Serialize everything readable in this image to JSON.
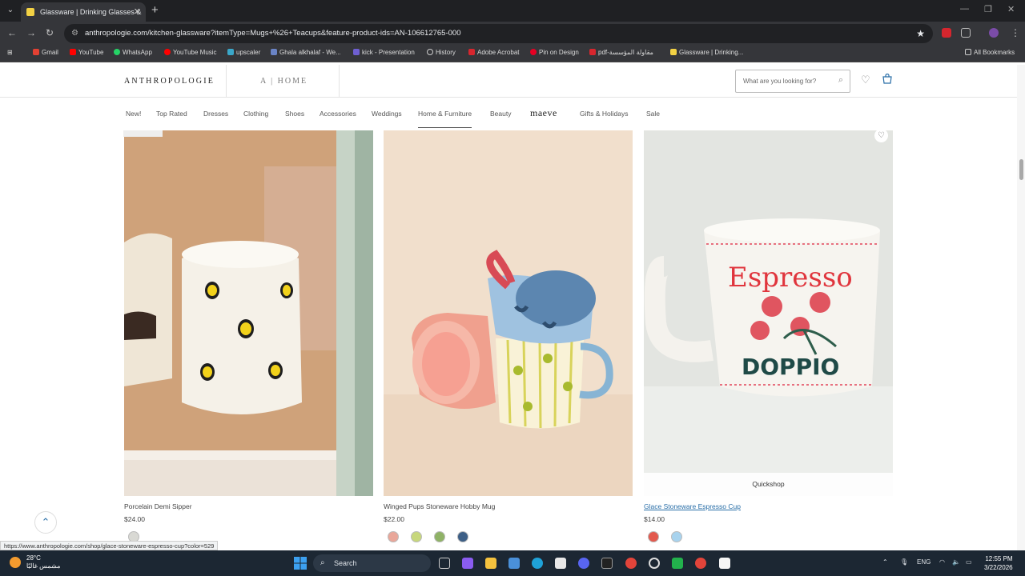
{
  "browser": {
    "tab_title": "Glassware | Drinking Glasses &",
    "url": "anthropologie.com/kitchen-glassware?itemType=Mugs+%26+Teacups&feature-product-ids=AN-106612765-000",
    "bookmarks": [
      "Gmail",
      "YouTube",
      "WhatsApp",
      "YouTube Music",
      "upscaler",
      "Ghala alkhalaf - We...",
      "kick - Presentation",
      "History",
      "Adobe Acrobat",
      "Pin on Design",
      "pdf-مقاولة المؤسسة",
      "Glassware | Drinking..."
    ],
    "all_bookmarks": "All Bookmarks"
  },
  "site": {
    "logo": "ANTHROPOLOGIE",
    "home_brand": "A | HOME",
    "search_placeholder": "What are you looking for?",
    "categories": [
      "New!",
      "Top Rated",
      "Dresses",
      "Clothing",
      "Shoes",
      "Accessories",
      "Weddings",
      "Home & Furniture",
      "Beauty",
      "maeve",
      "Gifts & Holidays",
      "Sale"
    ],
    "active_category": "Home & Furniture"
  },
  "products": [
    {
      "name": "Porcelain Demi Sipper",
      "price": "$24.00",
      "swatches": [
        "#d9d9d4"
      ]
    },
    {
      "name": "Winged Pups Stoneware Hobby Mug",
      "price": "$22.00",
      "swatches": [
        "#e9a79a",
        "#c7d77c",
        "#8fb266",
        "#3d5f86"
      ]
    },
    {
      "name": "Glace Stoneware Espresso Cup",
      "price": "$14.00",
      "swatches": [
        "#e35a4e",
        "#a8d3ee"
      ]
    }
  ],
  "quickshop_label": "Quickshop",
  "status_url": "https://www.anthropologie.com/shop/glace-stoneware-espresso-cup?color=529",
  "taskbar": {
    "temperature": "28°C",
    "weather_text": "مشمس غالبًا",
    "search_label": "Search",
    "language": "ENG",
    "time": "12:55 PM",
    "date": "3/22/2026"
  },
  "colors": {
    "accent_link": "#2a6fa8",
    "chrome_dark": "#35363a"
  }
}
